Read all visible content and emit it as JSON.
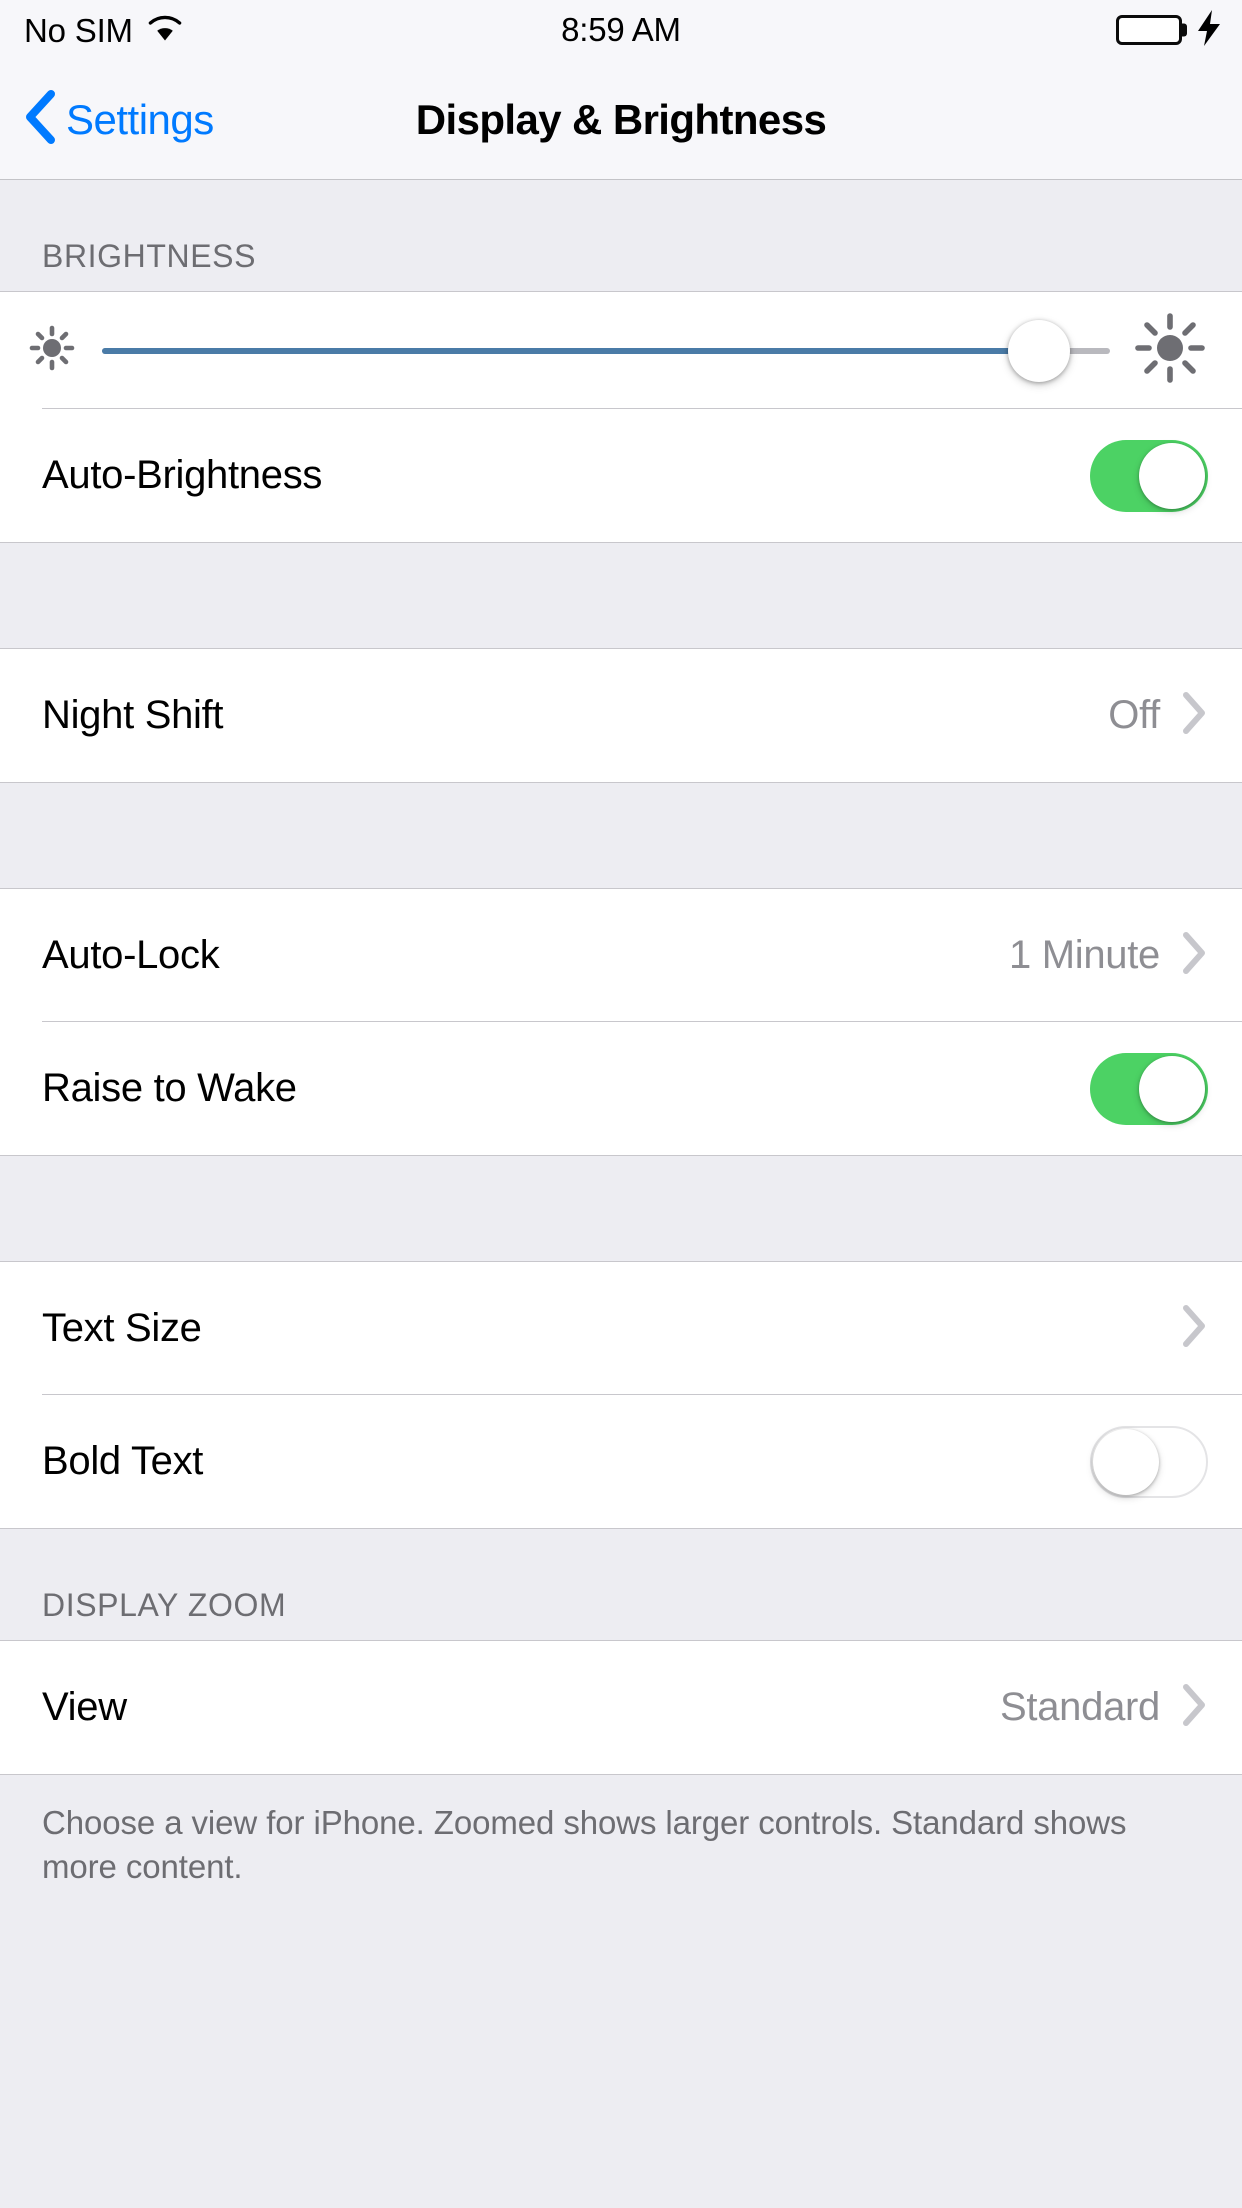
{
  "status_bar": {
    "carrier": "No SIM",
    "time": "8:59 AM",
    "wifi_icon": "wifi-icon",
    "battery_icon": "battery-icon",
    "battery_level_percent": 12,
    "charging_icon": "lightning-bolt-icon"
  },
  "nav": {
    "back_label": "Settings",
    "back_icon": "chevron-left-icon",
    "title": "Display & Brightness"
  },
  "sections": {
    "brightness": {
      "header": "BRIGHTNESS",
      "slider": {
        "name": "brightness-slider",
        "value_percent": 93,
        "min_icon": "sun-small-icon",
        "max_icon": "sun-large-icon",
        "track_color": "#4A7BA7"
      },
      "auto_brightness": {
        "label": "Auto-Brightness",
        "toggle_state": "on",
        "toggle_color": "#4CD264"
      }
    },
    "night_shift": {
      "label": "Night Shift",
      "value": "Off",
      "chevron_icon": "chevron-right-icon"
    },
    "lock": {
      "auto_lock": {
        "label": "Auto-Lock",
        "value": "1 Minute",
        "chevron_icon": "chevron-right-icon"
      },
      "raise_to_wake": {
        "label": "Raise to Wake",
        "toggle_state": "on",
        "toggle_color": "#4CD264"
      }
    },
    "text": {
      "text_size": {
        "label": "Text Size",
        "chevron_icon": "chevron-right-icon"
      },
      "bold_text": {
        "label": "Bold Text",
        "toggle_state": "off"
      }
    },
    "display_zoom": {
      "header": "DISPLAY ZOOM",
      "view": {
        "label": "View",
        "value": "Standard",
        "chevron_icon": "chevron-right-icon"
      },
      "footer": "Choose a view for iPhone. Zoomed shows larger controls. Standard shows more content."
    }
  },
  "colors": {
    "accent_blue": "#007AFF",
    "toggle_green": "#4CD264",
    "group_background": "#FFFFFF",
    "page_background": "#EDEDF2",
    "secondary_text": "#8E8E93",
    "header_text": "#6D6D72"
  }
}
